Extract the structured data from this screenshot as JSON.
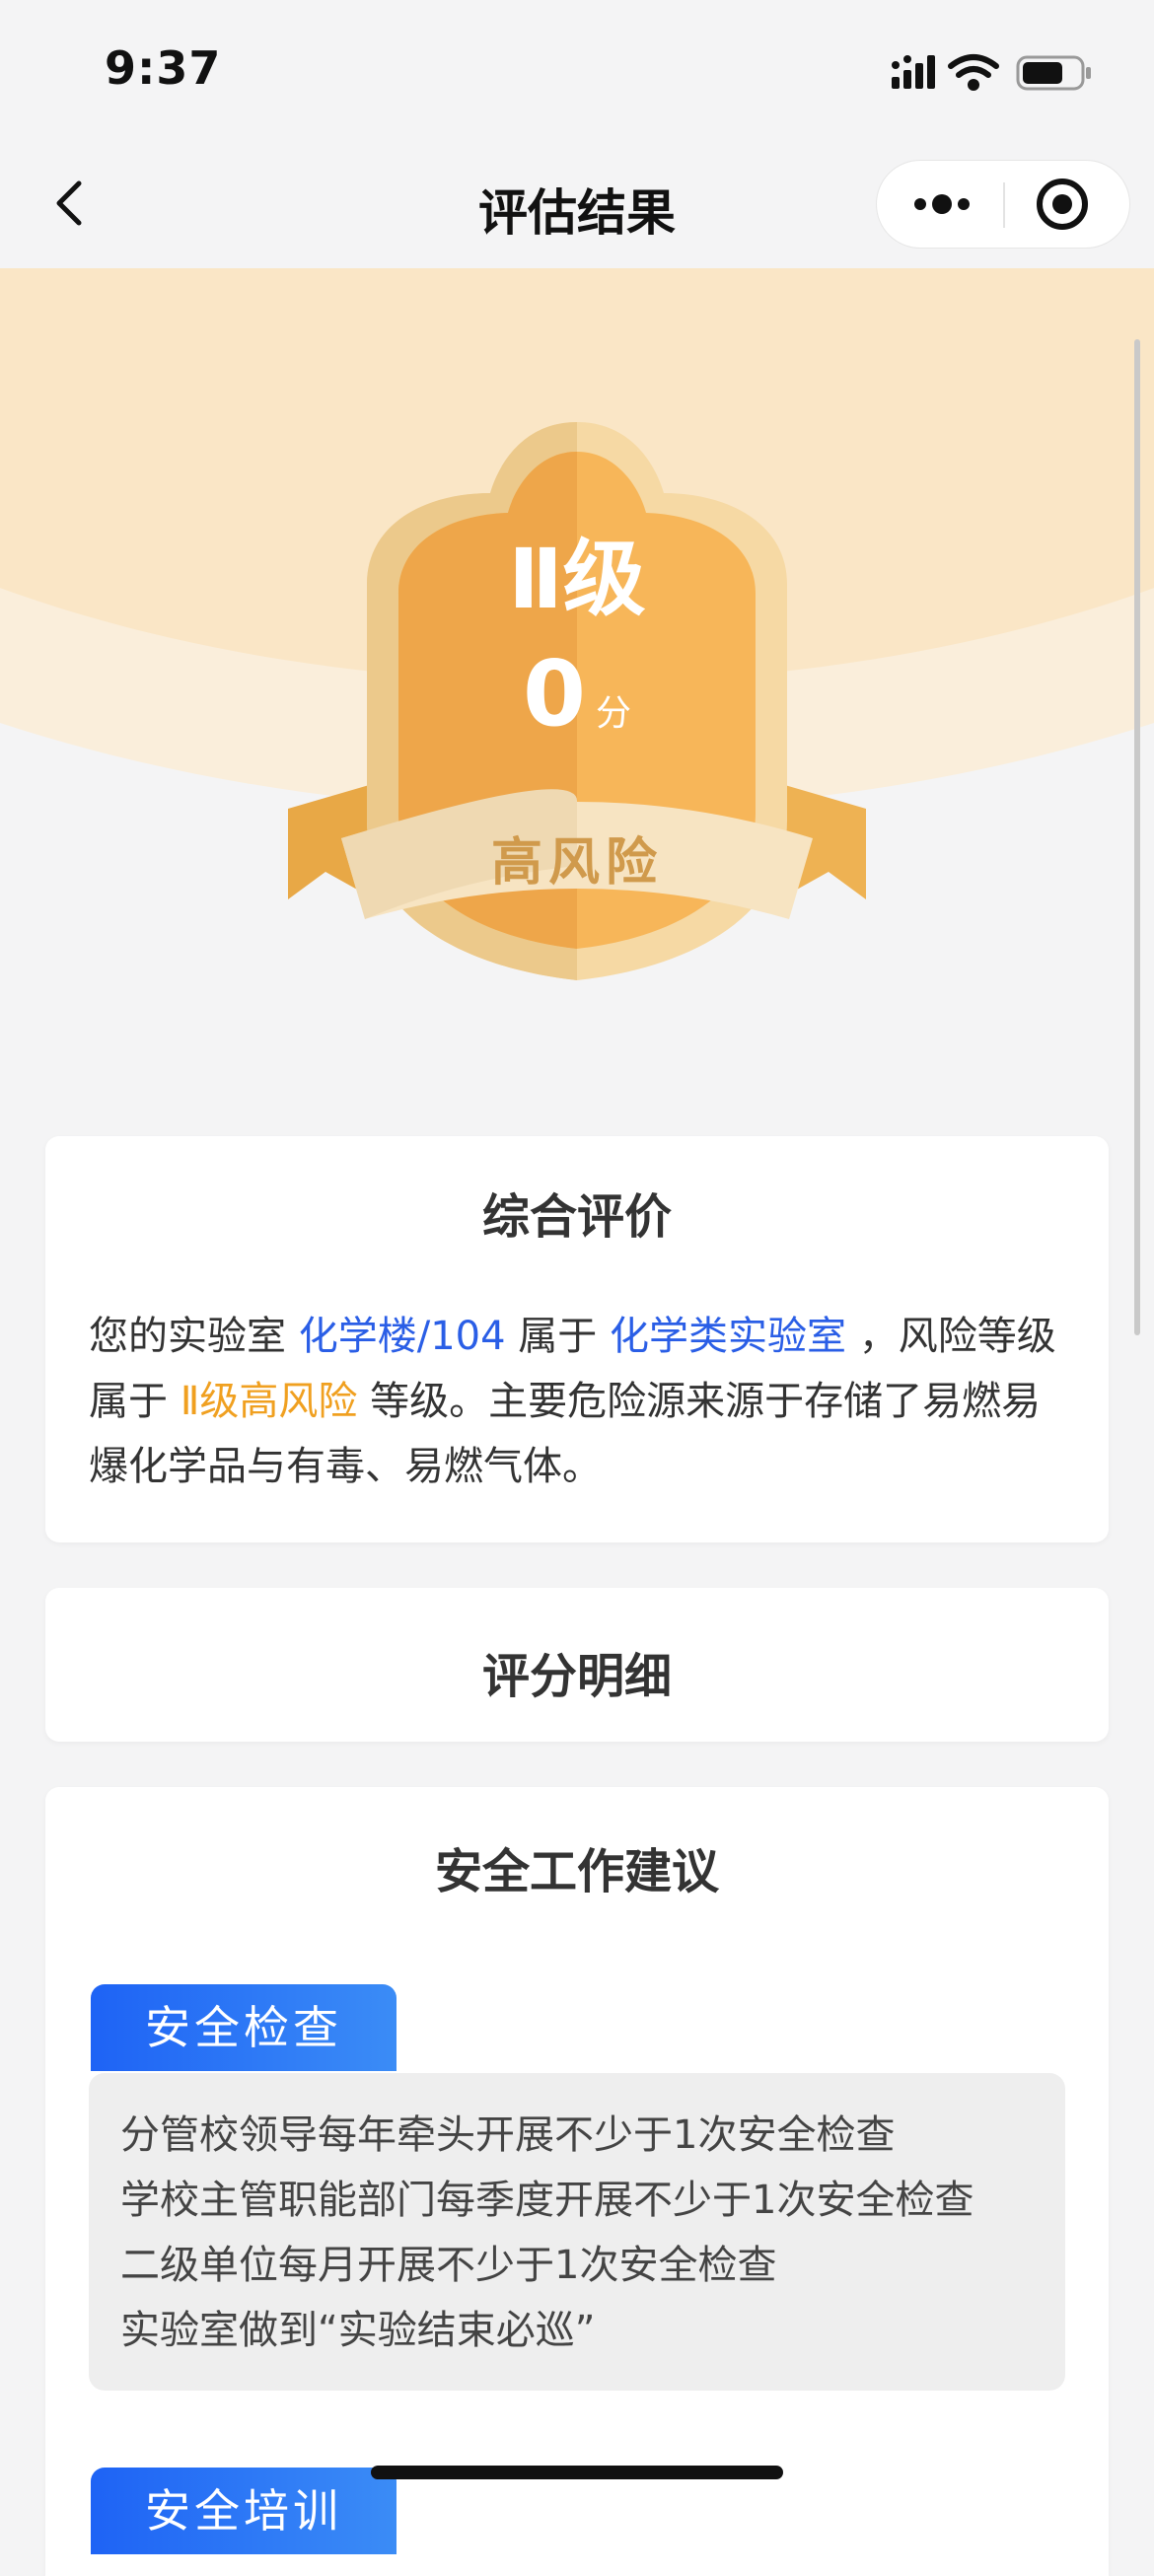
{
  "status_bar": {
    "time": "9:37"
  },
  "nav": {
    "title": "评估结果"
  },
  "badge": {
    "level": "Ⅱ级",
    "score": "0",
    "score_unit": "分",
    "risk": "高风险"
  },
  "summary": {
    "title": "综合评价",
    "t1": "您的实验室 ",
    "location": "化学楼/104",
    "t2": " 属于 ",
    "lab_type": "化学类实验室",
    "t3": " ，风险等级属于 ",
    "risk_level": "Ⅱ级高风险",
    "t4": " 等级。主要危险源来源于存储了易燃易爆化学品与有毒、易燃气体。"
  },
  "detail": {
    "title": "评分明细"
  },
  "advice": {
    "title": "安全工作建议",
    "sections": [
      {
        "tag": "安全检查",
        "lines": [
          "分管校领导每年牵头开展不少于1次安全检查",
          "学校主管职能部门每季度开展不少于1次安全检查",
          "二级单位每月开展不少于1次安全检查",
          "实验室做到“实验结束必巡”"
        ]
      },
      {
        "tag": "安全培训"
      }
    ]
  },
  "colors": {
    "accent_blue": "#2a5ee6",
    "accent_orange": "#f0a020",
    "badge_orange": "#f4b04e"
  },
  "icons": [
    "back-icon",
    "more-icon",
    "close-target-icon",
    "signal-icon",
    "wifi-icon",
    "battery-icon"
  ]
}
